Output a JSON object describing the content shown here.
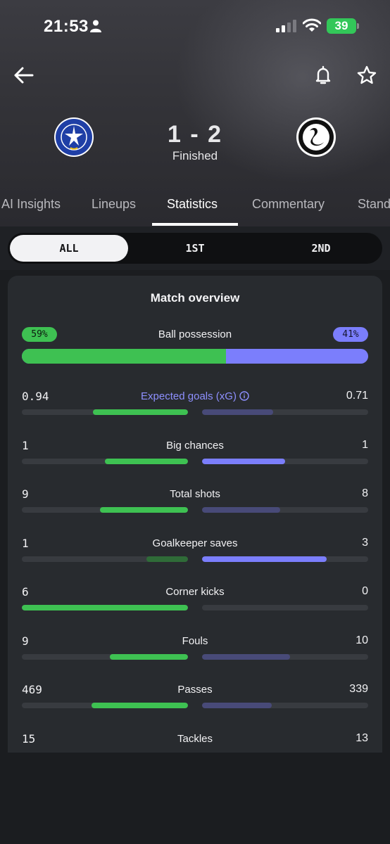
{
  "status_bar": {
    "time": "21:53",
    "battery": "39"
  },
  "header": {
    "score": "1 - 2",
    "status": "Finished",
    "home_crest_icon": "portsmouth-crest-icon",
    "away_crest_icon": "swansea-crest-icon"
  },
  "tabs": [
    "AI Insights",
    "Lineups",
    "Statistics",
    "Commentary",
    "Standings"
  ],
  "tabs_visible": [
    "AI Insights",
    "Lineups",
    "Statistics",
    "Commentary",
    "Stand"
  ],
  "active_tab": "Statistics",
  "periods": [
    "ALL",
    "1ST",
    "2ND"
  ],
  "active_period": "ALL",
  "colors": {
    "home": "#3ec152",
    "away": "#7b7efc",
    "home_dim": "#2f6b38",
    "away_dim": "#484a78"
  },
  "overview": {
    "title": "Match overview",
    "possession": {
      "label": "Ball possession",
      "home": "59%",
      "away": "41%",
      "home_value": 59,
      "away_value": 41
    },
    "stats": [
      {
        "label": "Expected goals (xG)",
        "home": "0.94",
        "away": "0.71",
        "home_fill": 0.57,
        "away_fill": 0.43,
        "home_leads": true,
        "accent": true
      },
      {
        "label": "Big chances",
        "home": "1",
        "away": "1",
        "home_fill": 0.5,
        "away_fill": 0.5,
        "home_leads": true,
        "away_leads": true
      },
      {
        "label": "Total shots",
        "home": "9",
        "away": "8",
        "home_fill": 0.53,
        "away_fill": 0.47,
        "home_leads": true
      },
      {
        "label": "Goalkeeper saves",
        "home": "1",
        "away": "3",
        "home_fill": 0.25,
        "away_fill": 0.75,
        "away_leads": true
      },
      {
        "label": "Corner kicks",
        "home": "6",
        "away": "0",
        "home_fill": 1.0,
        "away_fill": 0,
        "home_leads": true
      },
      {
        "label": "Fouls",
        "home": "9",
        "away": "10",
        "home_fill": 0.47,
        "away_fill": 0.53,
        "home_leads": true
      },
      {
        "label": "Passes",
        "home": "469",
        "away": "339",
        "home_fill": 0.58,
        "away_fill": 0.42,
        "home_leads": true
      },
      {
        "label": "Tackles",
        "home": "15",
        "away": "13"
      }
    ]
  }
}
